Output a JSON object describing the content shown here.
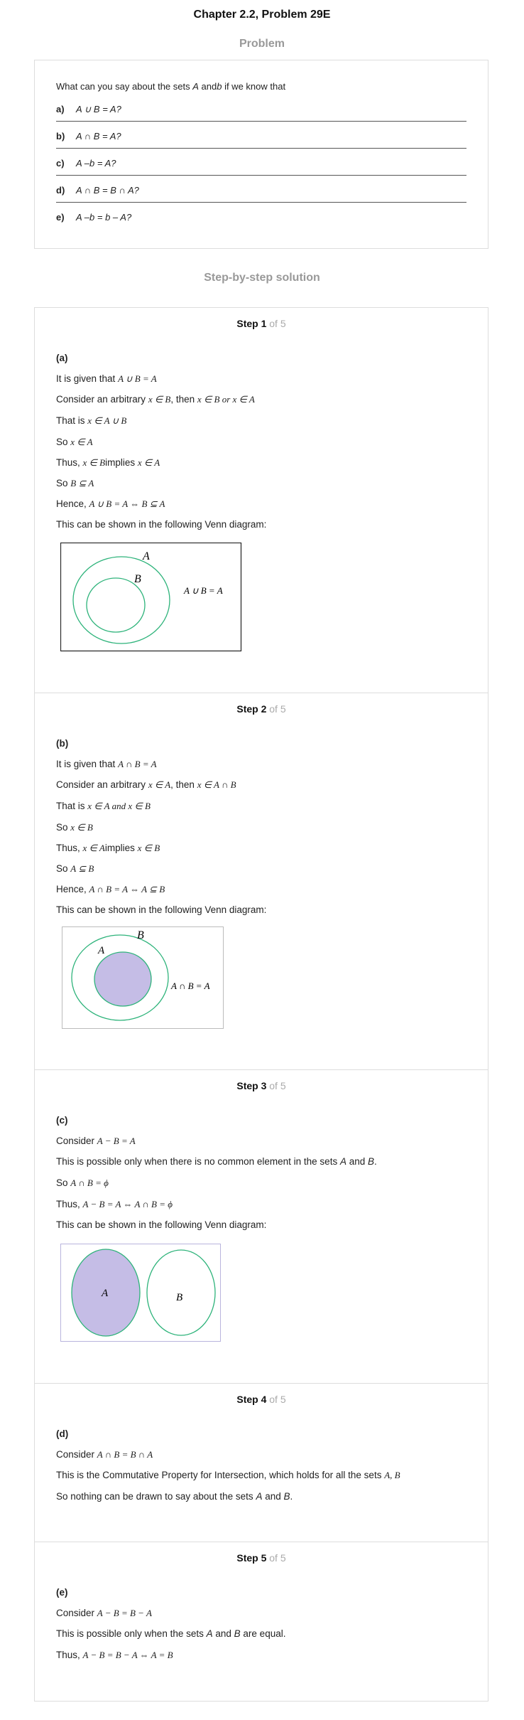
{
  "header": {
    "title": "Chapter 2.2, Problem 29E",
    "problem_heading": "Problem",
    "solution_heading": "Step-by-step solution"
  },
  "problem": {
    "intro_pre": "What can you say about the sets ",
    "intro_a": "A",
    "intro_mid": " and",
    "intro_b": "b",
    "intro_post": " if we know that",
    "items": [
      {
        "label": "a)",
        "text": "A ∪ B = A?"
      },
      {
        "label": "b)",
        "text": "A ∩ B = A?"
      },
      {
        "label": "c)",
        "text": "A –b = A?"
      },
      {
        "label": "d)",
        "text": "A ∩ B = B ∩ A?"
      },
      {
        "label": "e)",
        "text": "A –b = b – A?"
      }
    ]
  },
  "steps": [
    {
      "num": "Step 1",
      "of": " of 5",
      "part": "(a)",
      "l1": "It is given that",
      "l1m": "A ∪ B = A",
      "l2": "Consider an arbitrary",
      "l2m1": "x ∈ B",
      "l2t": ", then",
      "l2m2": "x ∈ B or x ∈ A",
      "l3": "That is",
      "l3m": "x ∈ A ∪ B",
      "l4": "So",
      "l4m": "x ∈ A",
      "l5": "Thus,",
      "l5m1": "x ∈ B",
      "l5t": "implies",
      "l5m2": "x ∈ A",
      "l6": "So",
      "l6m": "B ⊆ A",
      "l7": "Hence,",
      "l7m": "A ∪ B = A ⇔ B ⊆ A",
      "l8": "This can be shown in the following Venn diagram:",
      "venn": {
        "A": "A",
        "B": "B",
        "eq": "A ∪ B = A",
        "color": "#2db37a"
      }
    },
    {
      "num": "Step 2",
      "of": " of 5",
      "part": "(b)",
      "l1": "It is given that",
      "l1m": "A ∩ B = A",
      "l2": "Consider an arbitrary",
      "l2m1": "x ∈ A",
      "l2t": ", then",
      "l2m2": "x ∈ A ∩ B",
      "l3": "That is",
      "l3m": "x ∈ A and x ∈ B",
      "l4": "So",
      "l4m": "x ∈ B",
      "l5": "Thus,",
      "l5m1": "x ∈ A",
      "l5t": "implies",
      "l5m2": "x ∈ B",
      "l6": "So",
      "l6m": "A ⊆ B",
      "l7": "Hence,",
      "l7m": "A ∩ B = A ⇔ A ⊆ B",
      "l8": "This can be shown in the following Venn diagram:",
      "venn": {
        "A": "A",
        "B": "B",
        "eq": "A ∩ B = A",
        "fill": "#c5bde6"
      }
    },
    {
      "num": "Step 3",
      "of": " of 5",
      "part": "(c)",
      "l1": "Consider",
      "l1m": "A − B = A",
      "l2": "This is possible only when there is no common element in the sets ",
      "l2a": "A",
      "l2and": " and ",
      "l2b": "B",
      "l2end": ".",
      "l3": "So",
      "l3m": "A ∩ B = ϕ",
      "l4": "Thus,",
      "l4m": "A − B = A ⇔ A ∩ B = ϕ",
      "l5": "This can be shown in the following Venn diagram:",
      "venn": {
        "A": "A",
        "B": "B"
      }
    },
    {
      "num": "Step 4",
      "of": " of 5",
      "part": "(d)",
      "l1": "Consider",
      "l1m": "A ∩ B = B ∩ A",
      "l2": "This is the Commutative Property for Intersection, which holds for all the sets",
      "l2m": "A, B",
      "l3": "So nothing can be drawn to say about the sets ",
      "l3a": "A",
      "l3and": " and ",
      "l3b": "B",
      "l3end": "."
    },
    {
      "num": "Step 5",
      "of": " of 5",
      "part": "(e)",
      "l1": "Consider",
      "l1m": "A − B = B − A",
      "l2": "This is possible only when the sets ",
      "l2a": "A",
      "l2and": " and ",
      "l2b": "B",
      "l2end": " are equal.",
      "l3": "Thus,",
      "l3m": "A − B = B − A ⇔ A = B"
    }
  ]
}
